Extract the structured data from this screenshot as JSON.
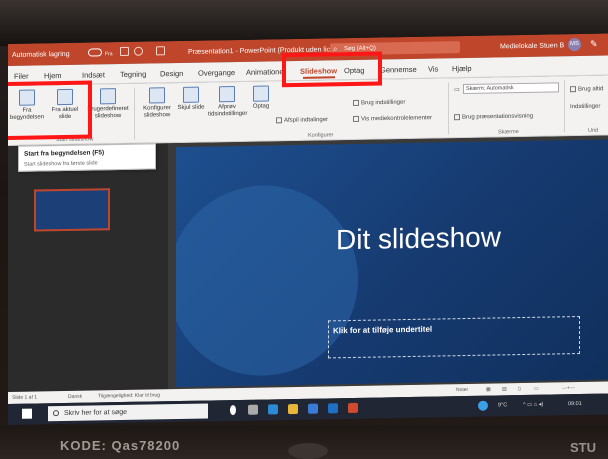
{
  "window": {
    "autosave_label": "Automatisk lagring",
    "autosave_state": "Fra",
    "doc_title": "Præsentation1 - PowerPoint (Produkt uden licens)",
    "search_placeholder": "Søg (Alt+Q)",
    "user_name": "Medielokale Stuen B",
    "user_initials": "MS"
  },
  "tabs": {
    "items": [
      "Filer",
      "Hjem",
      "Indsæt",
      "Tegning",
      "Design",
      "Overgange",
      "Animationer",
      "Slideshow",
      "Optag",
      "Gennemse",
      "Vis",
      "Hjælp"
    ],
    "active": "Slideshow"
  },
  "ribbon": {
    "from_beginning": "Fra begyndelsen",
    "from_current": "Fra aktuel slide",
    "custom_show": "Brugerdefineret slideshow",
    "group_start": "Start slideshow",
    "setup": "Konfigurer slideshow",
    "hide_slide": "Skjul slide",
    "rehearse": "Afprøv tidsindstillinger",
    "record": "Optag",
    "play_narrations": "Afspil indtalinger",
    "use_timings": "Brug indstillinger",
    "show_media_controls": "Vis mediekontrolelementer",
    "group_setup": "Konfigurer",
    "monitor_label": "Skærm: Automatisk",
    "presenter_view": "Brug præsentationsvisning",
    "group_monitors": "Skærme",
    "always_use": "Brug altid",
    "captions": "Indstillinger",
    "group_captions": "Und"
  },
  "tooltip": {
    "title": "Start fra begyndelsen (F5)",
    "description": "Start slideshow fra første slide"
  },
  "slide": {
    "title": "Dit slideshow",
    "subtitle_placeholder": "Klik for at tilføje undertitel"
  },
  "statusbar": {
    "slide_count": "Slide 1 af 1",
    "language": "Dansk",
    "accessibility": "Tilgængelighed: Klar til brug",
    "notes": "Noter"
  },
  "taskbar": {
    "search_placeholder": "Skriv her for at søge",
    "weather": "9°C",
    "time": "09:01"
  },
  "photo": {
    "sticker_text": "KODE: Qas78200",
    "brand_right": "STU"
  },
  "colors": {
    "accent": "#c0462b",
    "slide_bg": "#1e4f8f",
    "annotation": "#ff1616"
  }
}
